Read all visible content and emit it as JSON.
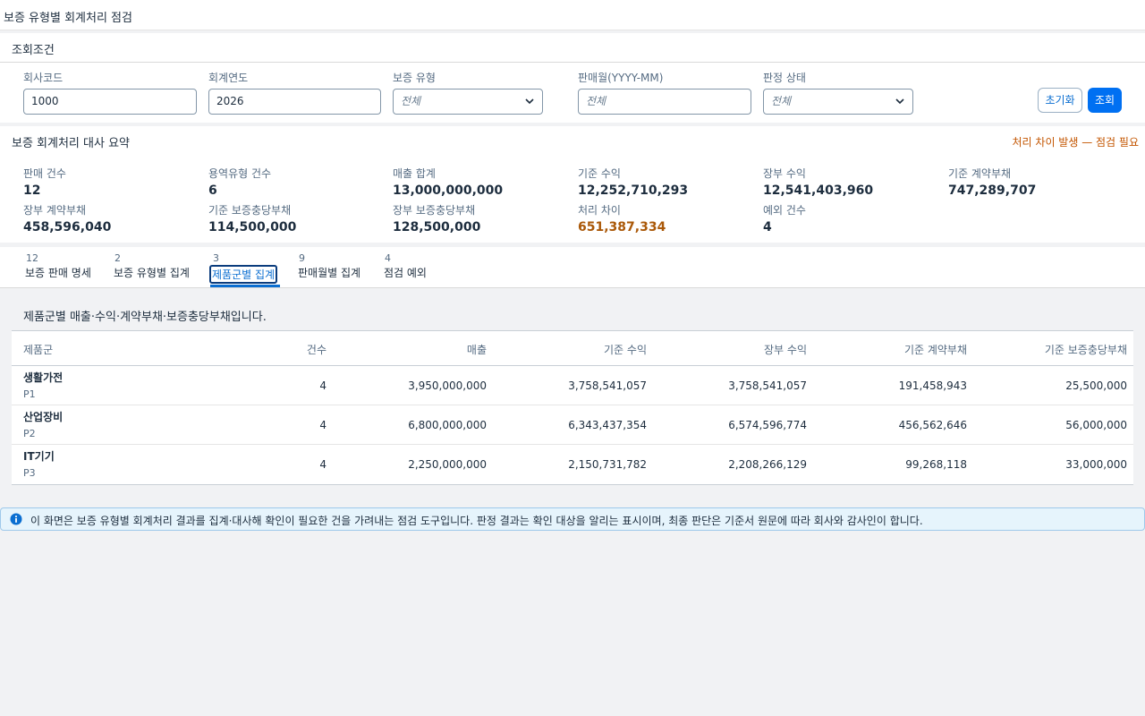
{
  "page": {
    "title": "보증 유형별 회계처리 점검"
  },
  "filters": {
    "title": "조회조건",
    "company_code": {
      "label": "회사코드",
      "value": "1000"
    },
    "fiscal_year": {
      "label": "회계연도",
      "value": "2026"
    },
    "warranty_type": {
      "label": "보증 유형",
      "placeholder": "전체"
    },
    "sales_month": {
      "label": "판매월(YYYY-MM)",
      "placeholder": "전체"
    },
    "judgment_status": {
      "label": "판정 상태",
      "placeholder": "전체"
    },
    "reset_label": "초기화",
    "search_label": "조회"
  },
  "summary": {
    "title": "보증 회계처리 대사 요약",
    "warning": "처리 차이 발생 — 점검 필요",
    "kpis": [
      {
        "label": "판매 건수",
        "value": "12"
      },
      {
        "label": "용역유형 건수",
        "value": "6"
      },
      {
        "label": "매출 합계",
        "value": "13,000,000,000"
      },
      {
        "label": "기준 수익",
        "value": "12,252,710,293"
      },
      {
        "label": "장부 수익",
        "value": "12,541,403,960"
      },
      {
        "label": "기준 계약부채",
        "value": "747,289,707"
      },
      {
        "label": "장부 계약부채",
        "value": "458,596,040"
      },
      {
        "label": "기준 보증충당부채",
        "value": "114,500,000"
      },
      {
        "label": "장부 보증충당부채",
        "value": "128,500,000"
      },
      {
        "label": "처리 차이",
        "value": "651,387,334"
      },
      {
        "label": "예외 건수",
        "value": "4"
      }
    ]
  },
  "tabs": [
    {
      "count": "12",
      "label": "보증 판매 명세"
    },
    {
      "count": "2",
      "label": "보증 유형별 집계"
    },
    {
      "count": "3",
      "label": "제품군별 집계"
    },
    {
      "count": "9",
      "label": "판매월별 집계"
    },
    {
      "count": "4",
      "label": "점검 예외"
    }
  ],
  "table": {
    "description": "제품군별 매출·수익·계약부채·보증충당부채입니다.",
    "columns": [
      "제품군",
      "건수",
      "매출",
      "기준 수익",
      "장부 수익",
      "기준 계약부채",
      "기준 보증충당부채"
    ],
    "rows": [
      {
        "name": "생활가전",
        "code": "P1",
        "count": "4",
        "sales": "3,950,000,000",
        "std_revenue": "3,758,541,057",
        "book_revenue": "3,758,541,057",
        "std_contract_liab": "191,458,943",
        "std_warranty_prov": "25,500,000"
      },
      {
        "name": "산업장비",
        "code": "P2",
        "count": "4",
        "sales": "6,800,000,000",
        "std_revenue": "6,343,437,354",
        "book_revenue": "6,574,596,774",
        "std_contract_liab": "456,562,646",
        "std_warranty_prov": "56,000,000"
      },
      {
        "name": "IT기기",
        "code": "P3",
        "count": "4",
        "sales": "2,250,000,000",
        "std_revenue": "2,150,731,782",
        "book_revenue": "2,208,266,129",
        "std_contract_liab": "99,268,118",
        "std_warranty_prov": "33,000,000"
      }
    ]
  },
  "info": {
    "text": "이 화면은 보증 유형별 회계처리 결과를 집계·대사해 확인이 필요한 건을 가려내는 점검 도구입니다. 판정 결과는 확인 대상을 알리는 표시이며, 최종 판단은 기준서 원문에 따라 회사와 감사인이 합니다."
  },
  "colors": {
    "accent": "#0070f2",
    "warning": "#aa5808",
    "info_bg": "#e6f4fc"
  }
}
